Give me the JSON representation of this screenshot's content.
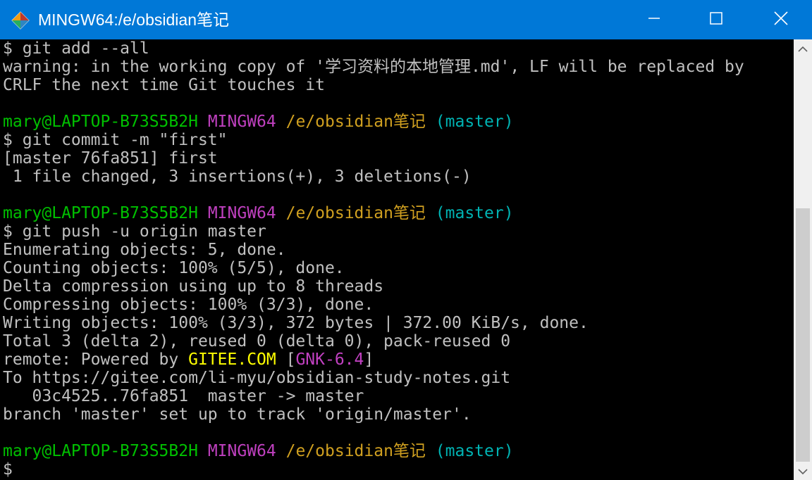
{
  "window": {
    "title": "MINGW64:/e/obsidian笔记",
    "titlebar_color": "#0078d7",
    "icons": {
      "app": "git-bash-icon",
      "minimize": "minimize-icon",
      "maximize": "maximize-icon",
      "close": "close-icon"
    }
  },
  "terminal": {
    "lines": [
      [
        {
          "t": "$ git add --all",
          "c": "text"
        }
      ],
      [
        {
          "t": "warning: in the working copy of '学习资料的本地管理.md', LF will be replaced by",
          "c": "text"
        }
      ],
      [
        {
          "t": "CRLF the next time Git touches it",
          "c": "text"
        }
      ],
      [],
      [
        {
          "t": "mary@LAPTOP-B73S5B2H",
          "c": "user"
        },
        {
          "t": " ",
          "c": "text"
        },
        {
          "t": "MINGW64",
          "c": "sys"
        },
        {
          "t": " ",
          "c": "text"
        },
        {
          "t": "/e/obsidian笔记",
          "c": "path"
        },
        {
          "t": " ",
          "c": "text"
        },
        {
          "t": "(master)",
          "c": "branch"
        }
      ],
      [
        {
          "t": "$ git commit -m \"first\"",
          "c": "text"
        }
      ],
      [
        {
          "t": "[master 76fa851] first",
          "c": "text"
        }
      ],
      [
        {
          "t": " 1 file changed, 3 insertions(+), 3 deletions(-)",
          "c": "text"
        }
      ],
      [],
      [
        {
          "t": "mary@LAPTOP-B73S5B2H",
          "c": "user"
        },
        {
          "t": " ",
          "c": "text"
        },
        {
          "t": "MINGW64",
          "c": "sys"
        },
        {
          "t": " ",
          "c": "text"
        },
        {
          "t": "/e/obsidian笔记",
          "c": "path"
        },
        {
          "t": " ",
          "c": "text"
        },
        {
          "t": "(master)",
          "c": "branch"
        }
      ],
      [
        {
          "t": "$ git push -u origin master",
          "c": "text"
        }
      ],
      [
        {
          "t": "Enumerating objects: 5, done.",
          "c": "text"
        }
      ],
      [
        {
          "t": "Counting objects: 100% (5/5), done.",
          "c": "text"
        }
      ],
      [
        {
          "t": "Delta compression using up to 8 threads",
          "c": "text"
        }
      ],
      [
        {
          "t": "Compressing objects: 100% (3/3), done.",
          "c": "text"
        }
      ],
      [
        {
          "t": "Writing objects: 100% (3/3), 372 bytes | 372.00 KiB/s, done.",
          "c": "text"
        }
      ],
      [
        {
          "t": "Total 3 (delta 2), reused 0 (delta 0), pack-reused 0",
          "c": "text"
        }
      ],
      [
        {
          "t": "remote: Powered by ",
          "c": "text"
        },
        {
          "t": "GITEE.COM",
          "c": "gitee"
        },
        {
          "t": " [",
          "c": "text"
        },
        {
          "t": "GNK-6.4",
          "c": "gnk"
        },
        {
          "t": "]",
          "c": "text"
        }
      ],
      [
        {
          "t": "To https://gitee.com/li-myu/obsidian-study-notes.git",
          "c": "text"
        }
      ],
      [
        {
          "t": "   03c4525..76fa851  master -> master",
          "c": "text"
        }
      ],
      [
        {
          "t": "branch 'master' set up to track 'origin/master'.",
          "c": "text"
        }
      ],
      [],
      [
        {
          "t": "mary@LAPTOP-B73S5B2H",
          "c": "user"
        },
        {
          "t": " ",
          "c": "text"
        },
        {
          "t": "MINGW64",
          "c": "sys"
        },
        {
          "t": " ",
          "c": "text"
        },
        {
          "t": "/e/obsidian笔记",
          "c": "path"
        },
        {
          "t": " ",
          "c": "text"
        },
        {
          "t": "(master)",
          "c": "branch"
        }
      ],
      [
        {
          "t": "$",
          "c": "text"
        }
      ]
    ],
    "colors": {
      "background": "#000000",
      "text": "#c0c0c0",
      "user": "#00c000",
      "sys": "#bf40bf",
      "path": "#d0a020",
      "branch": "#00b3b3",
      "gitee": "#ffff00",
      "gnk": "#c040c0"
    }
  },
  "scrollbar": {
    "icons": {
      "up": "scroll-up-arrow-icon",
      "down": "scroll-down-arrow-icon"
    }
  }
}
